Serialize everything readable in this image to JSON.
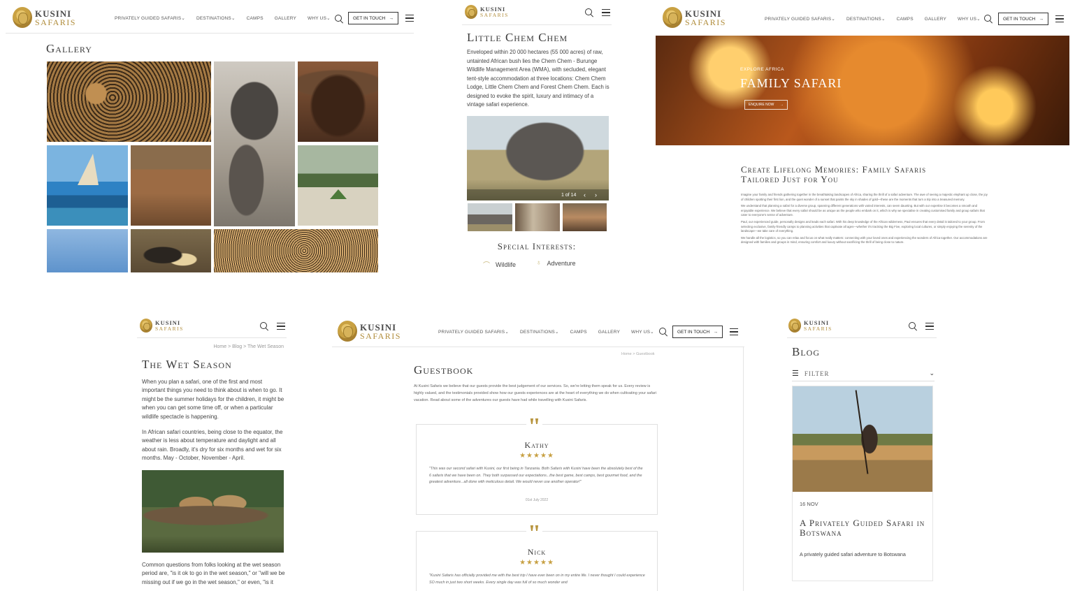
{
  "brand": {
    "name": "KUSINI",
    "sub": "SAFARIS"
  },
  "nav": {
    "items": [
      "PRIVATELY GUIDED SAFARIS",
      "DESTINATIONS",
      "CAMPS",
      "GALLERY",
      "WHY US"
    ],
    "cta": "GET IN TOUCH"
  },
  "gallery": {
    "title": "Gallery"
  },
  "chem": {
    "title": "Little Chem Chem",
    "body": "Enveloped within 20 000 hectares (55 000 acres) of raw, untainted African bush lies the Chem Chem - Burunge Wildlife Management Area (WMA), with secluded, elegant tent-style accommodation at three locations: Chem Chem Lodge, Little Chem Chem and Forest Chem Chem. Each is designed to evoke the spirit, luxury and intimacy of a vintage safari experience.",
    "counter": "1 of 14",
    "interests_title": "Special Interests:",
    "interests": [
      "Wildlife",
      "Adventure"
    ]
  },
  "family": {
    "kicker": "EXPLORE AFRICA",
    "title": "FAMILY SAFARI",
    "cta": "ENQUIRE NOW",
    "heading": "Create Lifelong Memories: Family Safaris Tailored Just for You",
    "paras": [
      "Imagine your family and friends gathering together in the breathtaking landscapes of Africa, sharing the thrill of a safari adventure. The awe of seeing a majestic elephant up close, the joy of children spotting their first lion, and the quiet wonder of a sunset that paints the sky in shades of gold—these are the moments that turn a trip into a treasured memory.",
      "We understand that planning a safari for a diverse group, spanning different generations with varied interests, can seem daunting. But with our expertise it becomes a smooth and enjoyable experience. We believe that every safari should be as unique as the people who embark on it, which is why we specialise in creating customised family and group safaris that cater to everyone's sense of adventure.",
      "Paul, our experienced guide, personally designs and leads each safari. With his deep knowledge of the African wilderness, Paul ensures that every detail is tailored to your group. From selecting exclusive, family-friendly camps to planning activities that captivate all ages—whether it's tracking the Big Five, exploring local cultures, or simply enjoying the serenity of the landscape—we take care of everything.",
      "We handle all the logistics, so you can relax and focus on what really matters: connecting with your loved ones and experiencing the wonders of Africa together. Our accommodations are designed with families and groups in mind, ensuring comfort and luxury without sacrificing the thrill of being close to nature."
    ]
  },
  "wet": {
    "breadcrumb": "Home > Blog > The Wet Season",
    "title": "The Wet Season",
    "p1": "When you plan a safari, one of the first and most important things you need to think about is when to go. It might be the summer holidays for the children, it might be when you can get some time off, or when a particular wildlife spectacle is happening.",
    "p2": "In African safari countries, being close to the equator, the weather is less about temperature and daylight and all about rain. Broadly, it's dry for six months and wet for six months. May - October,  November - April.",
    "p3": "Common questions from folks looking at the wet season period are, \"is it ok to go in the wet season,\" or \"will we be missing out if we go in the wet season,\" or even, \"is it"
  },
  "guestbook": {
    "breadcrumb": "Home > Guestbook",
    "title": "Guestbook",
    "intro": "At Kusini Safaris we believe that our guests provide the best judgement of our services. So, we're letting them speak for us. Every review is highly valued, and the testimonials provided show how our guests experiences are at the heart of everything we do when cultivating your safari vacation. Read about some of the adventures our guests have had while travelling with Kusini Safaris.",
    "reviews": [
      {
        "name": "Kathy",
        "stars": "★★★★★",
        "text": "\"This was our second safari with Kusini, our first being in Tanzania. Both Safaris with Kusini have been the absolutely best of the 6 safaris that we have been on. They both surpassed our expectations...the best game, best camps, best gourmet food, and the greatest adventure...all done with meticulous detail. We would never use another operator!\"",
        "date": "01st July 2022"
      },
      {
        "name": "Nick",
        "stars": "★★★★★",
        "text": "\"Kusini Safaris has officially provided me with the best trip I have ever been on in my entire life. I never thought I could experience SO much in just two short weeks. Every single day was full of so much wonder and",
        "date": ""
      }
    ]
  },
  "blog": {
    "title": "Blog",
    "filter": "FILTER",
    "post": {
      "date": "16 NOV",
      "title": "A Privately Guided Safari in Botswana",
      "excerpt": "A privately guided safari adventure to Botswana"
    }
  },
  "icons": [
    "search-icon",
    "menu-icon",
    "arrow-right-icon",
    "chevron-down-icon",
    "filter-icon",
    "quote-icon",
    "star-icon",
    "lion-logo-icon"
  ]
}
